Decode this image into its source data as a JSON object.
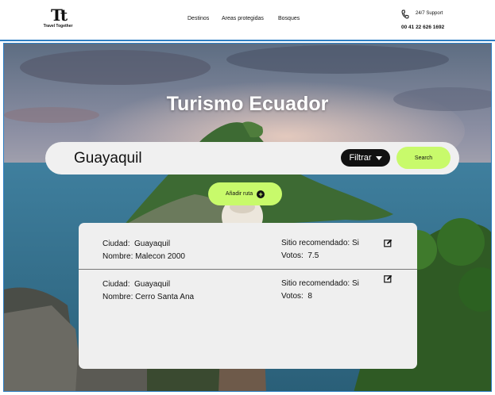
{
  "header": {
    "logo_mark": "Tt",
    "logo_text": "Travel Together",
    "nav": [
      "Destinos",
      "Areas protegidas",
      "Bosques"
    ],
    "support_label": "24/7 Support",
    "support_phone": "00 41 22 626 1692"
  },
  "hero": {
    "title": "Turismo Ecuador"
  },
  "search": {
    "value": "Guayaquil",
    "filter_label": "Filtrar",
    "search_label": "Search"
  },
  "add_route_label": "Añadir ruta",
  "results": [
    {
      "ciudad_label": "Ciudad:",
      "ciudad": "Guayaquil",
      "nombre_label": "Nombre:",
      "nombre": "Malecon 2000",
      "recomendado_label": "Sitio recomendado:",
      "recomendado": "Si",
      "votos_label": "Votos:",
      "votos": "7.5"
    },
    {
      "ciudad_label": "Ciudad:",
      "ciudad": "Guayaquil",
      "nombre_label": "Nombre:",
      "nombre": "Cerro Santa Ana",
      "recomendado_label": "Sitio recomendado:",
      "recomendado": "Si",
      "votos_label": "Votos:",
      "votos": "8"
    }
  ],
  "colors": {
    "accent_green": "#c8fa6b",
    "border_blue": "#2e7fc4",
    "dark": "#111111"
  },
  "icons": [
    "phone-icon",
    "chevron-down-icon",
    "plus-circle-icon",
    "edit-icon"
  ]
}
